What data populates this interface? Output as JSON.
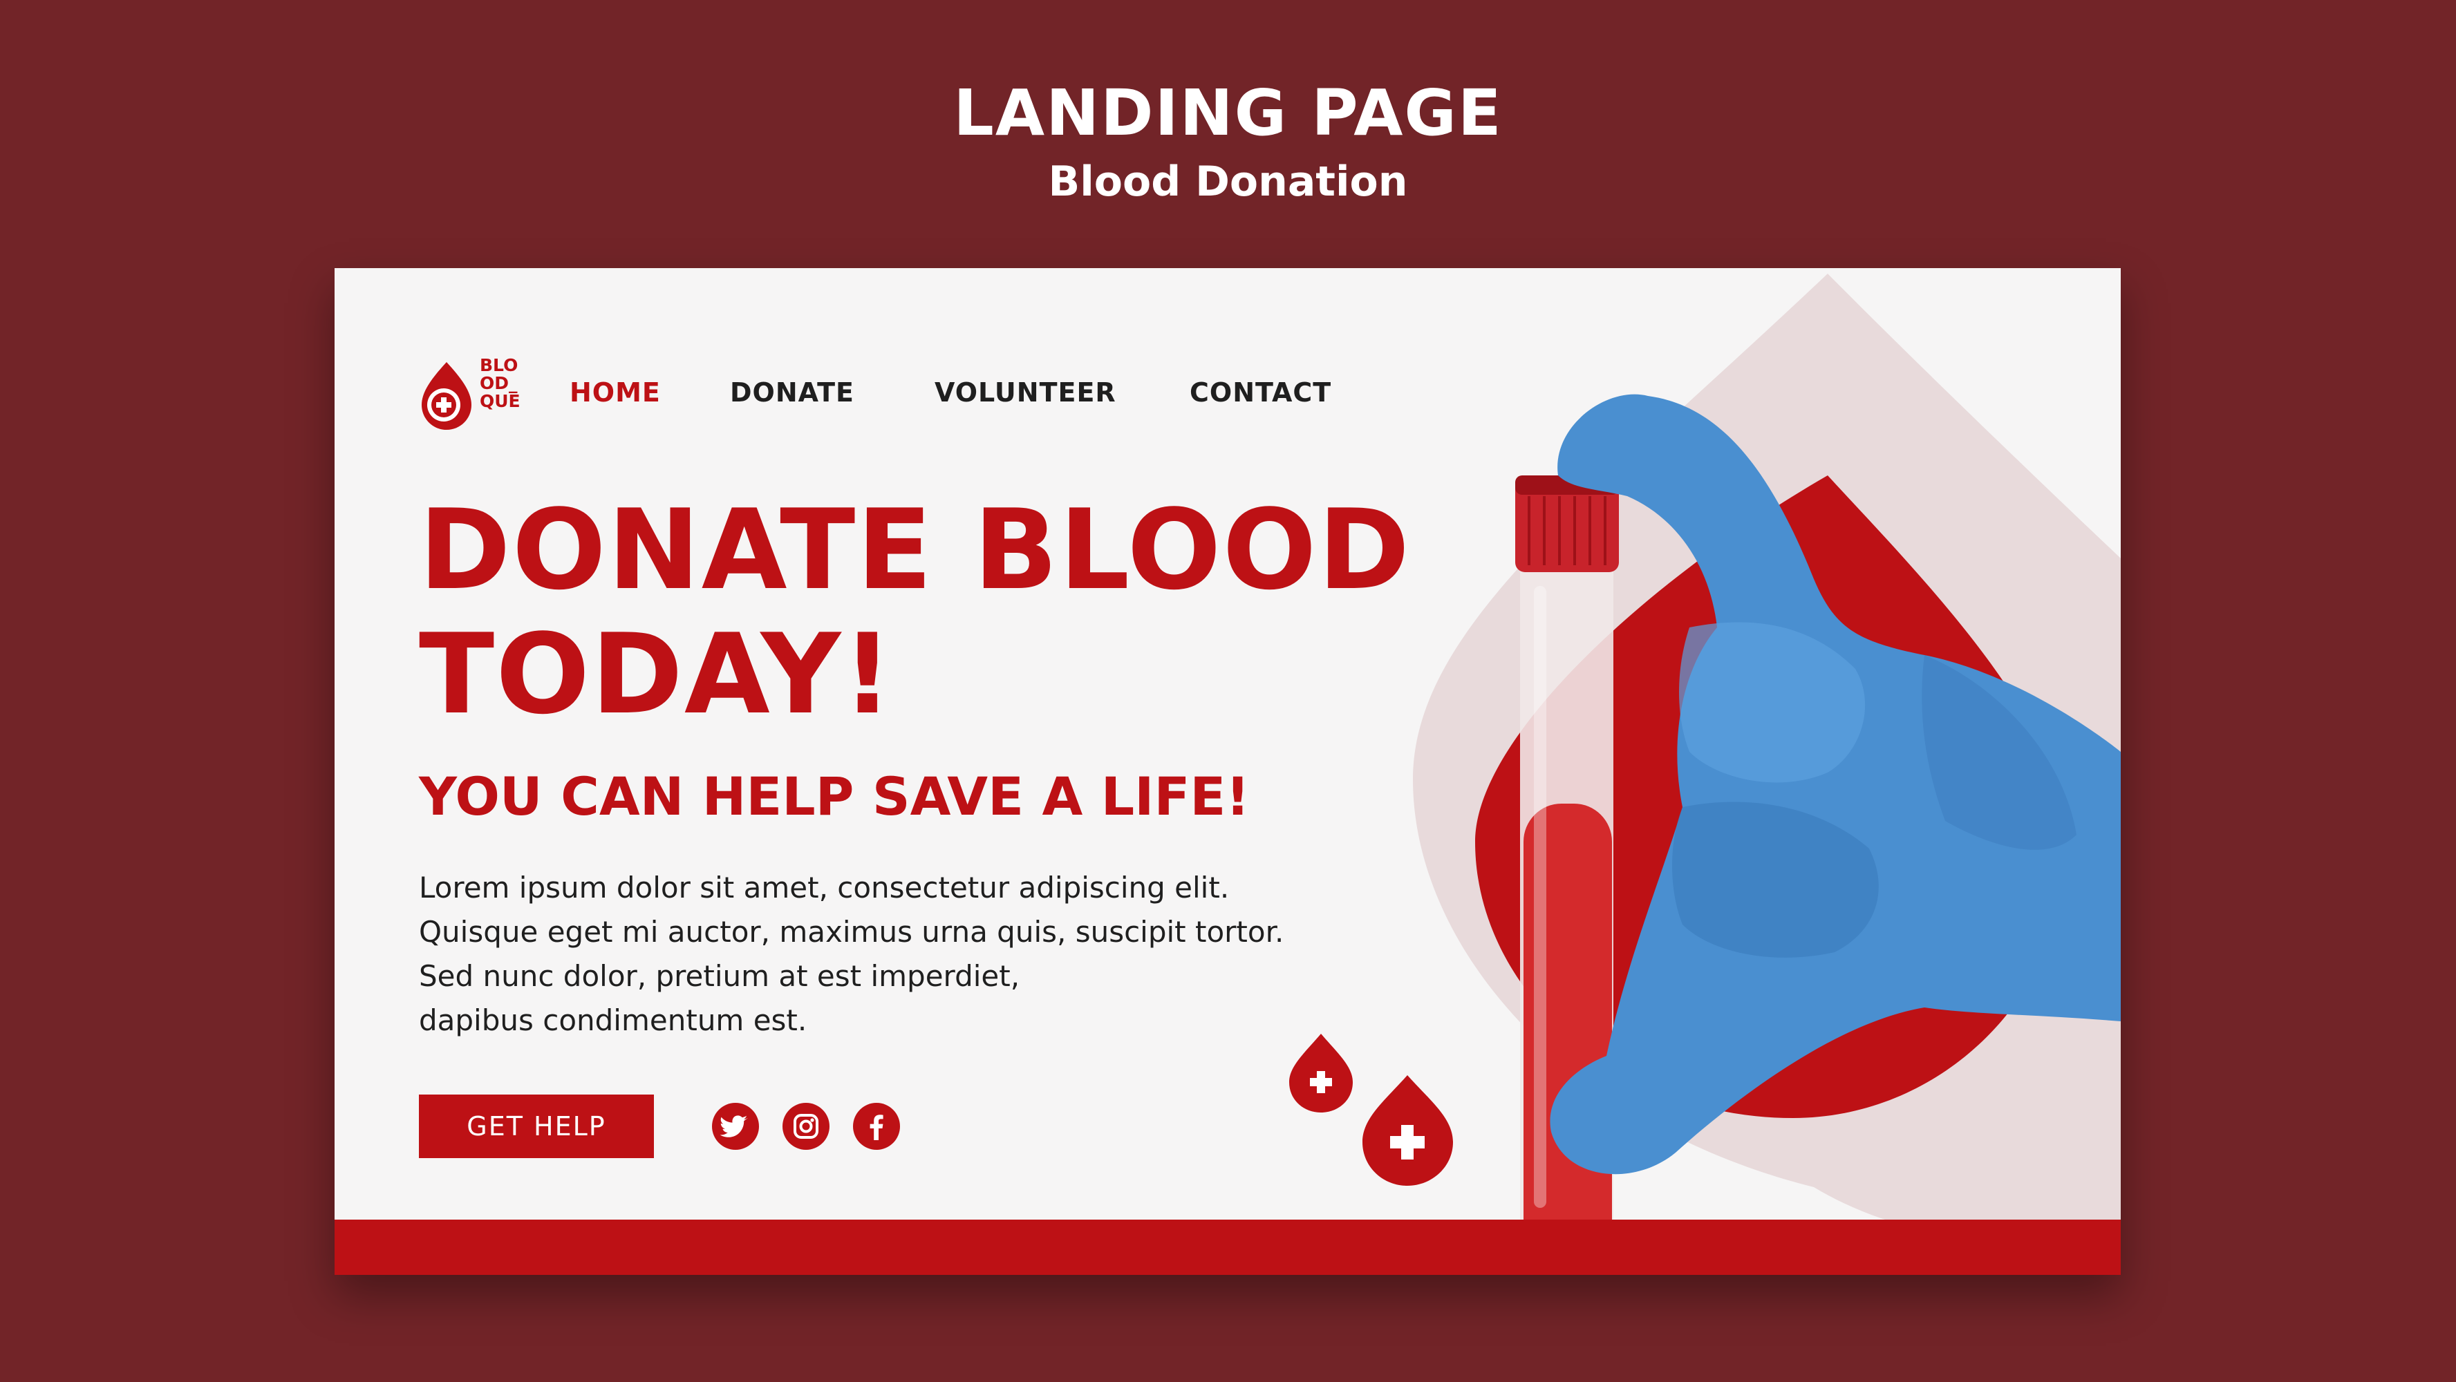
{
  "showcase": {
    "title": "LANDING PAGE",
    "subtitle": "Blood Donation"
  },
  "brand": {
    "logo_lines": [
      "BLO",
      "OD_",
      "QUE"
    ],
    "accent_color": "#bd1115",
    "background_color": "#722428"
  },
  "nav": {
    "items": [
      {
        "label": "HOME",
        "active": true
      },
      {
        "label": "DONATE",
        "active": false
      },
      {
        "label": "VOLUNTEER",
        "active": false
      },
      {
        "label": "CONTACT",
        "active": false
      }
    ]
  },
  "hero": {
    "headline_line1": "DONATE BLOOD",
    "headline_line2": "TODAY!",
    "subheadline": "YOU CAN HELP SAVE A LIFE!",
    "body_lines": [
      "Lorem ipsum dolor sit amet, consectetur adipiscing elit.",
      "Quisque eget mi auctor, maximus urna quis, suscipit tortor.",
      "Sed nunc dolor, pretium at est imperdiet,",
      "dapibus condimentum est."
    ],
    "cta_label": "GET HELP"
  },
  "social": {
    "icons": [
      "twitter-icon",
      "instagram-icon",
      "facebook-icon"
    ]
  }
}
